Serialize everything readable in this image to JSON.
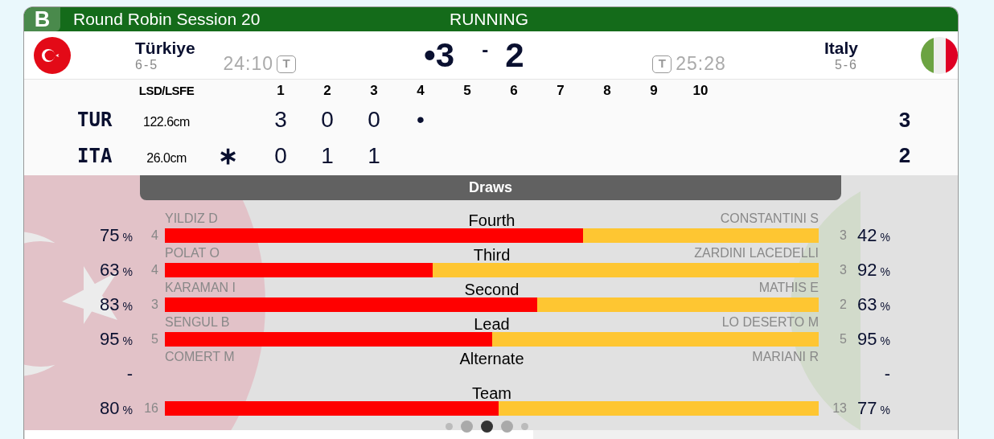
{
  "header": {
    "sheet": "B",
    "title": "Round Robin Session 20",
    "status": "RUNNING"
  },
  "teams": [
    {
      "name": "Türkiye",
      "record": "6-5",
      "time": "24:10",
      "timeout": "T",
      "score": "•3",
      "kind": "turkey"
    },
    {
      "name": "Italy",
      "record": "5-6",
      "time": "25:28",
      "timeout": "T",
      "score": "2",
      "kind": "italy"
    }
  ],
  "score_separator": "-",
  "linescore": {
    "lsd_label": "LSD/LSFE",
    "ends": [
      "1",
      "2",
      "3",
      "4",
      "5",
      "6",
      "7",
      "8",
      "9",
      "10"
    ],
    "rows": [
      {
        "code": "TUR",
        "lsd": "122.6cm",
        "mark": "",
        "ends": [
          "3",
          "0",
          "0",
          "•"
        ],
        "total": "3"
      },
      {
        "code": "ITA",
        "lsd": "26.0cm",
        "mark": "∗",
        "ends": [
          "0",
          "1",
          "1"
        ],
        "total": "2"
      }
    ]
  },
  "draws": {
    "title": "Draws",
    "rows": [
      {
        "kind": "bar",
        "position": "Fourth",
        "left_name": "YILDIZ D",
        "right_name": "CONSTANTINI S",
        "left_pct": "75",
        "left_count": "4",
        "right_count": "3",
        "right_pct": "42",
        "level": 0.64
      },
      {
        "kind": "bar",
        "position": "Third",
        "left_name": "POLAT O",
        "right_name": "ZARDINI LACEDELLI",
        "left_pct": "63",
        "left_count": "4",
        "right_count": "3",
        "right_pct": "92",
        "level": 0.41
      },
      {
        "kind": "bar",
        "position": "Second",
        "left_name": "KARAMAN I",
        "right_name": "MATHIS E",
        "left_pct": "83",
        "left_count": "3",
        "right_count": "2",
        "right_pct": "63",
        "level": 0.57
      },
      {
        "kind": "bar",
        "position": "Lead",
        "left_name": "SENGUL B",
        "right_name": "LO DESERTO M",
        "left_pct": "95",
        "left_count": "5",
        "right_count": "5",
        "right_pct": "95",
        "level": 0.5
      },
      {
        "kind": "empty",
        "position": "Alternate",
        "left_name": "COMERT M",
        "right_name": "MARIANI R",
        "left_pct": "-",
        "right_pct": "-"
      },
      {
        "kind": "bar",
        "position": "Team",
        "left_pct": "80",
        "left_count": "16",
        "right_count": "13",
        "right_pct": "77",
        "level": 0.51
      }
    ],
    "pct_unit": "%"
  },
  "carousel": [
    {
      "selected": false
    },
    {
      "selected": false
    },
    {
      "selected": true
    },
    {
      "selected": false
    },
    {
      "selected": false
    }
  ]
}
